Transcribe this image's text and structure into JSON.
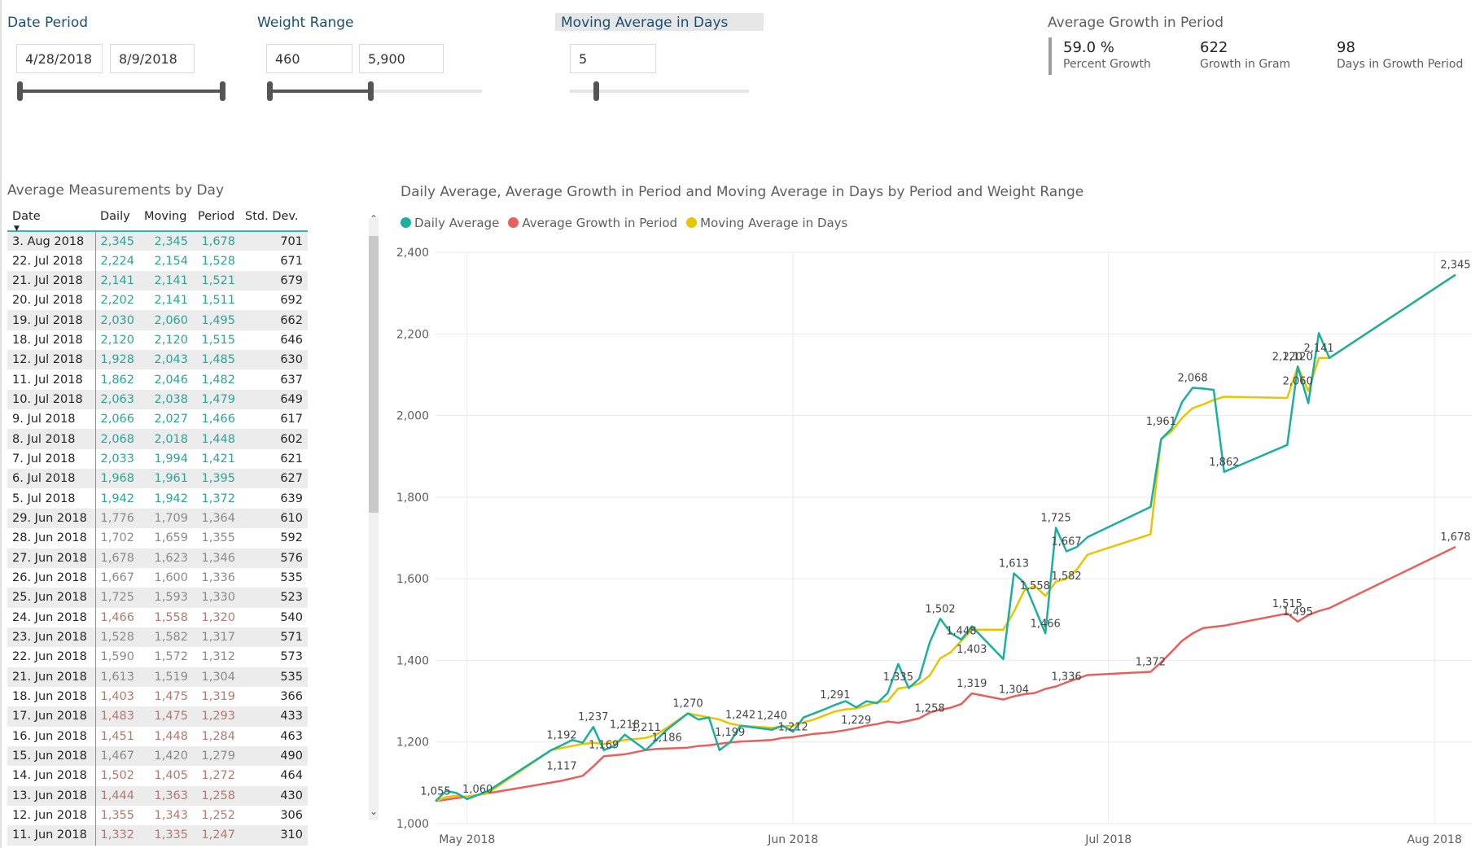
{
  "slicers": {
    "date_period": {
      "title": "Date Period",
      "start": "4/28/2018",
      "end": "8/9/2018"
    },
    "weight_range": {
      "title": "Weight Range",
      "min": "460",
      "max": "5,900"
    },
    "moving_average": {
      "title": "Moving Average in Days",
      "value": "5"
    }
  },
  "kpi": {
    "title": "Average Growth in Period",
    "items": [
      {
        "value": "59.0 %",
        "label": "Percent Growth"
      },
      {
        "value": "622",
        "label": "Growth in Gram"
      },
      {
        "value": "98",
        "label": "Days in Growth Period"
      }
    ]
  },
  "table": {
    "title": "Average Measurements by Day",
    "headers": [
      "Date",
      "Daily",
      "Moving",
      "Period",
      "Std. Dev."
    ],
    "rows": [
      [
        "3. Aug 2018",
        "2,345",
        "2,345",
        "1,678",
        "701"
      ],
      [
        "22. Jul 2018",
        "2,224",
        "2,154",
        "1,528",
        "671"
      ],
      [
        "21. Jul 2018",
        "2,141",
        "2,141",
        "1,521",
        "679"
      ],
      [
        "20. Jul 2018",
        "2,202",
        "2,141",
        "1,511",
        "692"
      ],
      [
        "19. Jul 2018",
        "2,030",
        "2,060",
        "1,495",
        "662"
      ],
      [
        "18. Jul 2018",
        "2,120",
        "2,120",
        "1,515",
        "646"
      ],
      [
        "12. Jul 2018",
        "1,928",
        "2,043",
        "1,485",
        "630"
      ],
      [
        "11. Jul 2018",
        "1,862",
        "2,046",
        "1,482",
        "637"
      ],
      [
        "10. Jul 2018",
        "2,063",
        "2,038",
        "1,479",
        "649"
      ],
      [
        "9. Jul 2018",
        "2,066",
        "2,027",
        "1,466",
        "617"
      ],
      [
        "8. Jul 2018",
        "2,068",
        "2,018",
        "1,448",
        "602"
      ],
      [
        "7. Jul 2018",
        "2,033",
        "1,994",
        "1,421",
        "621"
      ],
      [
        "6. Jul 2018",
        "1,968",
        "1,961",
        "1,395",
        "627"
      ],
      [
        "5. Jul 2018",
        "1,942",
        "1,942",
        "1,372",
        "639"
      ],
      [
        "29. Jun 2018",
        "1,776",
        "1,709",
        "1,364",
        "610"
      ],
      [
        "28. Jun 2018",
        "1,702",
        "1,659",
        "1,355",
        "592"
      ],
      [
        "27. Jun 2018",
        "1,678",
        "1,623",
        "1,346",
        "576"
      ],
      [
        "26. Jun 2018",
        "1,667",
        "1,600",
        "1,336",
        "535"
      ],
      [
        "25. Jun 2018",
        "1,725",
        "1,593",
        "1,330",
        "523"
      ],
      [
        "24. Jun 2018",
        "1,466",
        "1,558",
        "1,320",
        "540"
      ],
      [
        "23. Jun 2018",
        "1,528",
        "1,582",
        "1,317",
        "571"
      ],
      [
        "22. Jun 2018",
        "1,590",
        "1,572",
        "1,312",
        "573"
      ],
      [
        "21. Jun 2018",
        "1,613",
        "1,519",
        "1,304",
        "535"
      ],
      [
        "18. Jun 2018",
        "1,403",
        "1,475",
        "1,319",
        "366"
      ],
      [
        "17. Jun 2018",
        "1,483",
        "1,475",
        "1,293",
        "433"
      ],
      [
        "16. Jun 2018",
        "1,451",
        "1,448",
        "1,284",
        "463"
      ],
      [
        "15. Jun 2018",
        "1,467",
        "1,420",
        "1,279",
        "490"
      ],
      [
        "14. Jun 2018",
        "1,502",
        "1,405",
        "1,272",
        "464"
      ],
      [
        "13. Jun 2018",
        "1,444",
        "1,363",
        "1,258",
        "430"
      ],
      [
        "12. Jun 2018",
        "1,355",
        "1,343",
        "1,252",
        "306"
      ],
      [
        "11. Jun 2018",
        "1,332",
        "1,335",
        "1,247",
        "310"
      ]
    ],
    "row_colors": [
      "#2ba597",
      "#2ba597",
      "#2ba597",
      "#2ba597",
      "#2ba597",
      "#2ba597",
      "#2ba597",
      "#2ba597",
      "#2ba597",
      "#2ba597",
      "#2ba597",
      "#2ba597",
      "#2ba597",
      "#2ba597",
      "#8a8a8a",
      "#8a8a8a",
      "#8a8a8a",
      "#8a8a8a",
      "#8a8a8a",
      "#b07a6e",
      "#8a8a8a",
      "#8a8a8a",
      "#8a8a8a",
      "#b07a6e",
      "#b07a6e",
      "#b07a6e",
      "#8a8a8a",
      "#b07a6e",
      "#b07a6e",
      "#b07a6e",
      "#b07a6e"
    ]
  },
  "colors": {
    "daily": "#1aaf9f",
    "growth": "#e8605b",
    "moving": "#e8c500",
    "accent": "#2fb9aa"
  },
  "chart_data": {
    "type": "line",
    "title": "Daily Average, Average Growth in Period and Moving Average in Days by Period and Weight Range",
    "xlabel": "",
    "ylabel": "",
    "ylim": [
      1000,
      2400
    ],
    "yticks": [
      "1,000",
      "1,200",
      "1,400",
      "1,600",
      "1,800",
      "2,000",
      "2,200",
      "2,400"
    ],
    "xticks": [
      "May 2018",
      "Jun 2018",
      "Jul 2018",
      "Aug 2018"
    ],
    "xtick_dates": [
      "2018-05-01",
      "2018-06-01",
      "2018-07-01",
      "2018-08-01"
    ],
    "xlim": [
      "2018-04-28",
      "2018-08-03"
    ],
    "grid": true,
    "legend_position": "top-left",
    "series": [
      {
        "name": "Daily Average",
        "color": "#1aaf9f",
        "x": [
          "2018-04-28",
          "2018-04-29",
          "2018-04-30",
          "2018-05-01",
          "2018-05-02",
          "2018-05-03",
          "2018-05-09",
          "2018-05-10",
          "2018-05-11",
          "2018-05-12",
          "2018-05-13",
          "2018-05-14",
          "2018-05-15",
          "2018-05-16",
          "2018-05-18",
          "2018-05-19",
          "2018-05-20",
          "2018-05-22",
          "2018-05-23",
          "2018-05-24",
          "2018-05-25",
          "2018-05-26",
          "2018-05-27",
          "2018-05-30",
          "2018-05-31",
          "2018-06-01",
          "2018-06-02",
          "2018-06-03",
          "2018-06-04",
          "2018-06-05",
          "2018-06-06",
          "2018-06-07",
          "2018-06-08",
          "2018-06-09",
          "2018-06-10",
          "2018-06-11",
          "2018-06-12",
          "2018-06-13",
          "2018-06-14",
          "2018-06-15",
          "2018-06-16",
          "2018-06-17",
          "2018-06-18",
          "2018-06-21",
          "2018-06-22",
          "2018-06-23",
          "2018-06-24",
          "2018-06-25",
          "2018-06-26",
          "2018-06-27",
          "2018-06-28",
          "2018-06-29",
          "2018-07-05",
          "2018-07-06",
          "2018-07-07",
          "2018-07-08",
          "2018-07-09",
          "2018-07-10",
          "2018-07-11",
          "2018-07-12",
          "2018-07-18",
          "2018-07-19",
          "2018-07-20",
          "2018-07-21",
          "2018-07-22",
          "2018-08-03"
        ],
        "y": [
          1055,
          1080,
          1075,
          1060,
          1070,
          1080,
          1180,
          1192,
          1205,
          1198,
          1237,
          1180,
          1190,
          1218,
          1180,
          1205,
          1230,
          1270,
          1255,
          1260,
          1180,
          1199,
          1240,
          1230,
          1240,
          1225,
          1260,
          1270,
          1280,
          1291,
          1300,
          1285,
          1300,
          1295,
          1320,
          1391,
          1332,
          1355,
          1444,
          1502,
          1467,
          1451,
          1483,
          1403,
          1613,
          1590,
          1528,
          1466,
          1725,
          1667,
          1678,
          1702,
          1776,
          1942,
          1968,
          2033,
          2068,
          2066,
          2063,
          1862,
          1928,
          2120,
          2030,
          2202,
          2141,
          2345
        ]
      },
      {
        "name": "Average Growth in Period",
        "color": "#e8605b",
        "x": [
          "2018-04-28",
          "2018-05-02",
          "2018-05-10",
          "2018-05-12",
          "2018-05-13",
          "2018-05-14",
          "2018-05-16",
          "2018-05-18",
          "2018-05-19",
          "2018-05-22",
          "2018-05-23",
          "2018-05-24",
          "2018-05-26",
          "2018-05-27",
          "2018-05-30",
          "2018-05-31",
          "2018-06-01",
          "2018-06-02",
          "2018-06-03",
          "2018-06-04",
          "2018-06-05",
          "2018-06-06",
          "2018-06-07",
          "2018-06-08",
          "2018-06-09",
          "2018-06-10",
          "2018-06-11",
          "2018-06-12",
          "2018-06-13",
          "2018-06-14",
          "2018-06-15",
          "2018-06-16",
          "2018-06-17",
          "2018-06-18",
          "2018-06-21",
          "2018-06-22",
          "2018-06-23",
          "2018-06-24",
          "2018-06-25",
          "2018-06-26",
          "2018-06-27",
          "2018-06-28",
          "2018-06-29",
          "2018-07-05",
          "2018-07-06",
          "2018-07-07",
          "2018-07-08",
          "2018-07-09",
          "2018-07-10",
          "2018-07-11",
          "2018-07-12",
          "2018-07-18",
          "2018-07-19",
          "2018-07-20",
          "2018-07-21",
          "2018-07-22",
          "2018-08-03"
        ],
        "y": [
          1055,
          1070,
          1105,
          1117,
          1140,
          1165,
          1170,
          1180,
          1183,
          1186,
          1190,
          1192,
          1199,
          1201,
          1205,
          1210,
          1212,
          1216,
          1220,
          1222,
          1225,
          1229,
          1234,
          1240,
          1244,
          1250,
          1247,
          1252,
          1258,
          1272,
          1279,
          1284,
          1293,
          1319,
          1304,
          1312,
          1317,
          1320,
          1330,
          1336,
          1346,
          1355,
          1364,
          1372,
          1395,
          1421,
          1448,
          1466,
          1479,
          1482,
          1485,
          1515,
          1495,
          1511,
          1521,
          1528,
          1678
        ]
      },
      {
        "name": "Moving Average in Days",
        "color": "#e8c500",
        "x": [
          "2018-04-28",
          "2018-04-29",
          "2018-04-30",
          "2018-05-01",
          "2018-05-02",
          "2018-05-03",
          "2018-05-09",
          "2018-05-10",
          "2018-05-11",
          "2018-05-12",
          "2018-05-13",
          "2018-05-14",
          "2018-05-15",
          "2018-05-16",
          "2018-05-18",
          "2018-05-19",
          "2018-05-20",
          "2018-05-22",
          "2018-05-23",
          "2018-05-24",
          "2018-05-25",
          "2018-05-26",
          "2018-05-27",
          "2018-05-30",
          "2018-05-31",
          "2018-06-01",
          "2018-06-02",
          "2018-06-03",
          "2018-06-04",
          "2018-06-05",
          "2018-06-06",
          "2018-06-07",
          "2018-06-08",
          "2018-06-09",
          "2018-06-10",
          "2018-06-11",
          "2018-06-12",
          "2018-06-13",
          "2018-06-14",
          "2018-06-15",
          "2018-06-16",
          "2018-06-17",
          "2018-06-18",
          "2018-06-21",
          "2018-06-22",
          "2018-06-23",
          "2018-06-24",
          "2018-06-25",
          "2018-06-26",
          "2018-06-27",
          "2018-06-28",
          "2018-06-29",
          "2018-07-05",
          "2018-07-06",
          "2018-07-07",
          "2018-07-08",
          "2018-07-09",
          "2018-07-10",
          "2018-07-11",
          "2018-07-12",
          "2018-07-18",
          "2018-07-19",
          "2018-07-20",
          "2018-07-21",
          "2018-07-22",
          "2018-08-03"
        ],
        "y": [
          1055,
          1065,
          1068,
          1066,
          1070,
          1075,
          1180,
          1185,
          1190,
          1195,
          1198,
          1195,
          1200,
          1205,
          1210,
          1218,
          1235,
          1270,
          1265,
          1260,
          1255,
          1245,
          1240,
          1235,
          1238,
          1240,
          1248,
          1255,
          1265,
          1275,
          1280,
          1282,
          1290,
          1298,
          1300,
          1331,
          1335,
          1343,
          1363,
          1405,
          1420,
          1448,
          1475,
          1475,
          1519,
          1572,
          1582,
          1558,
          1593,
          1600,
          1623,
          1659,
          1709,
          1942,
          1961,
          1994,
          2018,
          2027,
          2038,
          2046,
          2043,
          2120,
          2060,
          2141,
          2141,
          2345
        ]
      }
    ],
    "data_labels": [
      {
        "date": "2018-04-28",
        "value": 1055,
        "text": "1,055"
      },
      {
        "date": "2018-05-02",
        "value": 1060,
        "text": "1,060"
      },
      {
        "date": "2018-05-10",
        "value": 1192,
        "text": "1,192"
      },
      {
        "date": "2018-05-10",
        "value": 1117,
        "text": "1,117"
      },
      {
        "date": "2018-05-13",
        "value": 1237,
        "text": "1,237"
      },
      {
        "date": "2018-05-14",
        "value": 1169,
        "text": "1,169"
      },
      {
        "date": "2018-05-16",
        "value": 1218,
        "text": "1,218"
      },
      {
        "date": "2018-05-18",
        "value": 1211,
        "text": "1,211"
      },
      {
        "date": "2018-05-20",
        "value": 1186,
        "text": "1,186"
      },
      {
        "date": "2018-05-22",
        "value": 1270,
        "text": "1,270"
      },
      {
        "date": "2018-05-27",
        "value": 1242,
        "text": "1,242"
      },
      {
        "date": "2018-05-26",
        "value": 1199,
        "text": "1,199"
      },
      {
        "date": "2018-05-30",
        "value": 1240,
        "text": "1,240"
      },
      {
        "date": "2018-06-01",
        "value": 1212,
        "text": "1,212"
      },
      {
        "date": "2018-06-05",
        "value": 1291,
        "text": "1,291"
      },
      {
        "date": "2018-06-07",
        "value": 1229,
        "text": "1,229"
      },
      {
        "date": "2018-06-11",
        "value": 1335,
        "text": "1,335"
      },
      {
        "date": "2018-06-14",
        "value": 1258,
        "text": "1,258"
      },
      {
        "date": "2018-06-15",
        "value": 1502,
        "text": "1,502"
      },
      {
        "date": "2018-06-17",
        "value": 1448,
        "text": "1,448"
      },
      {
        "date": "2018-06-18",
        "value": 1403,
        "text": "1,403"
      },
      {
        "date": "2018-06-18",
        "value": 1319,
        "text": "1,319"
      },
      {
        "date": "2018-06-22",
        "value": 1613,
        "text": "1,613"
      },
      {
        "date": "2018-06-22",
        "value": 1304,
        "text": "1,304"
      },
      {
        "date": "2018-06-24",
        "value": 1558,
        "text": "1,558"
      },
      {
        "date": "2018-06-25",
        "value": 1466,
        "text": "1,466"
      },
      {
        "date": "2018-06-26",
        "value": 1725,
        "text": "1,725"
      },
      {
        "date": "2018-06-27",
        "value": 1667,
        "text": "1,667"
      },
      {
        "date": "2018-06-27",
        "value": 1582,
        "text": "1,582"
      },
      {
        "date": "2018-06-27",
        "value": 1336,
        "text": "1,336"
      },
      {
        "date": "2018-07-05",
        "value": 1372,
        "text": "1,372"
      },
      {
        "date": "2018-07-06",
        "value": 1961,
        "text": "1,961"
      },
      {
        "date": "2018-07-09",
        "value": 2068,
        "text": "2,068"
      },
      {
        "date": "2018-07-12",
        "value": 1862,
        "text": "1,862"
      },
      {
        "date": "2018-07-18",
        "value": 2120,
        "text": "2,120"
      },
      {
        "date": "2018-07-19",
        "value": 2120,
        "text": "2,120"
      },
      {
        "date": "2018-07-19",
        "value": 2060,
        "text": "2,060"
      },
      {
        "date": "2018-07-21",
        "value": 2141,
        "text": "2,141"
      },
      {
        "date": "2018-07-18",
        "value": 1515,
        "text": "1,515"
      },
      {
        "date": "2018-07-19",
        "value": 1495,
        "text": "1,495"
      },
      {
        "date": "2018-08-03",
        "value": 2345,
        "text": "2,345"
      },
      {
        "date": "2018-08-03",
        "value": 1678,
        "text": "1,678"
      }
    ]
  }
}
